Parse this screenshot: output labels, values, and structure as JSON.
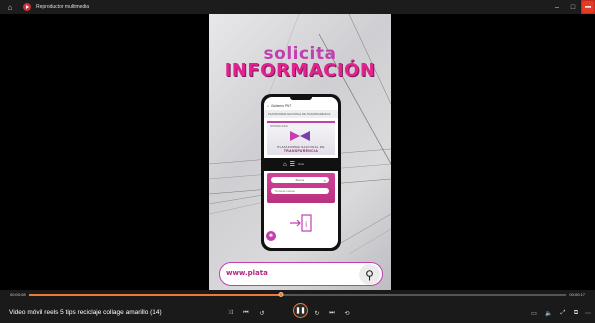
{
  "window": {
    "title": "Reproductor multimedia",
    "badge_text": "■■■"
  },
  "video": {
    "promo_line1": "solicita",
    "promo_line2": "INFORMACIÓN",
    "phone": {
      "browser_text": "Gobierno PNT",
      "site_bar_text": "PLATAFORMA NACIONAL DE TRANSPARENCIA",
      "banner_heading": "SISTEMA SISAI",
      "banner_caption": "PLATAFORMA NACIONAL DE",
      "banner_caption2": "TRANSPARENCIA",
      "blackbar_text": "Inicio",
      "field1_text": "Buscar",
      "field2_text": "Tema de interés"
    },
    "url_text": "www.plata",
    "side_label": "PNT"
  },
  "player": {
    "time_current": "00:00:08",
    "time_total": "00:00:17",
    "progress_fraction": 0.47,
    "media_title": "Video móvil reels 5 tips reciclaje collage amarillo (14)",
    "controls": {
      "shuffle_icon": "⤨",
      "prev_icon": "⏮",
      "rewind_icon": "↺",
      "play_pause_icon": "❚❚",
      "forward_icon": "↻",
      "next_icon": "⏭",
      "repeat_icon": "⟲",
      "subtitles_icon": "▭",
      "volume_icon": "🔈",
      "fullscreen_icon": "⤢",
      "miniplayer_icon": "⧉",
      "more_icon": "⋯"
    },
    "accent_color": "#e87a3a"
  }
}
